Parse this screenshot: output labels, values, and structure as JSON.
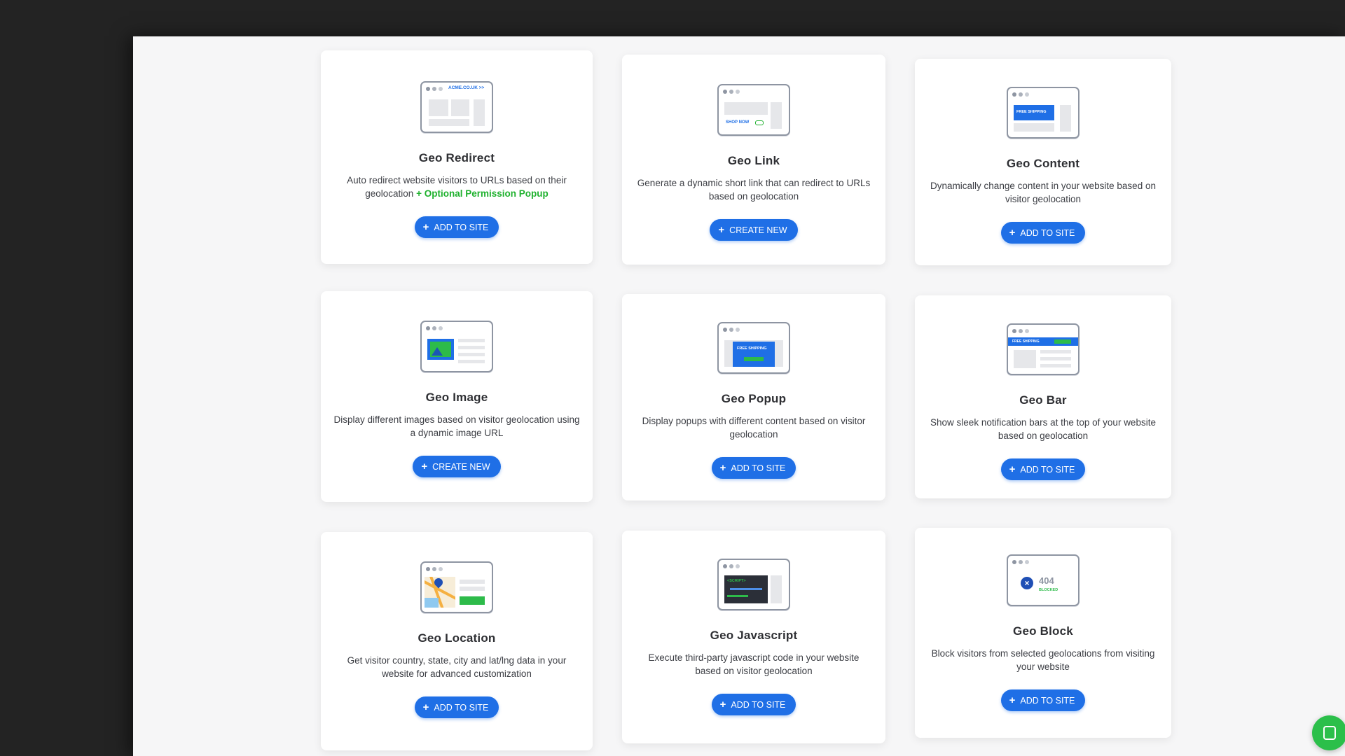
{
  "cards": [
    {
      "title": "Geo Redirect",
      "desc": "Auto redirect website visitors to URLs based on their geolocation",
      "highlight": "+ Optional Permission Popup",
      "button": "ADD TO SITE",
      "illustration": {
        "label": "ACME.CO.UK >>"
      }
    },
    {
      "title": "Geo Link",
      "desc": "Generate a dynamic short link that can redirect to URLs based on geolocation",
      "button": "CREATE NEW",
      "illustration": {
        "label": "SHOP NOW"
      }
    },
    {
      "title": "Geo Content",
      "desc": "Dynamically change content in your website based on visitor geolocation",
      "button": "ADD TO SITE",
      "illustration": {
        "label": "FREE SHIPPING"
      }
    },
    {
      "title": "Geo Image",
      "desc": "Display different images based on visitor geolocation using a dynamic image URL",
      "button": "CREATE NEW"
    },
    {
      "title": "Geo Popup",
      "desc": "Display popups with different content based on visitor geolocation",
      "button": "ADD TO SITE",
      "illustration": {
        "label": "FREE SHIPPING"
      }
    },
    {
      "title": "Geo Bar",
      "desc": "Show sleek notification bars at the top of your website based on geolocation",
      "button": "ADD TO SITE",
      "illustration": {
        "label": "FREE SHIPPING"
      }
    },
    {
      "title": "Geo Location",
      "desc": "Get visitor country, state, city and lat/lng data in your website for advanced customization",
      "button": "ADD TO SITE"
    },
    {
      "title": "Geo Javascript",
      "desc": "Execute third-party javascript code in your website based on visitor geolocation",
      "button": "ADD TO SITE",
      "illustration": {
        "label": "<SCRIPT>"
      }
    },
    {
      "title": "Geo Block",
      "desc": "Block visitors from selected geolocations from visiting your website",
      "button": "ADD TO SITE",
      "illustration": {
        "label": "404",
        "sublabel": "BLOCKED"
      }
    }
  ],
  "icons": {
    "button": "plus-icon",
    "chat": "chat-icon"
  },
  "colors": {
    "accent": "#1f6fe6",
    "highlight": "#1fb12e",
    "frame": "#8e95a2",
    "chat": "#2bbf4a"
  }
}
